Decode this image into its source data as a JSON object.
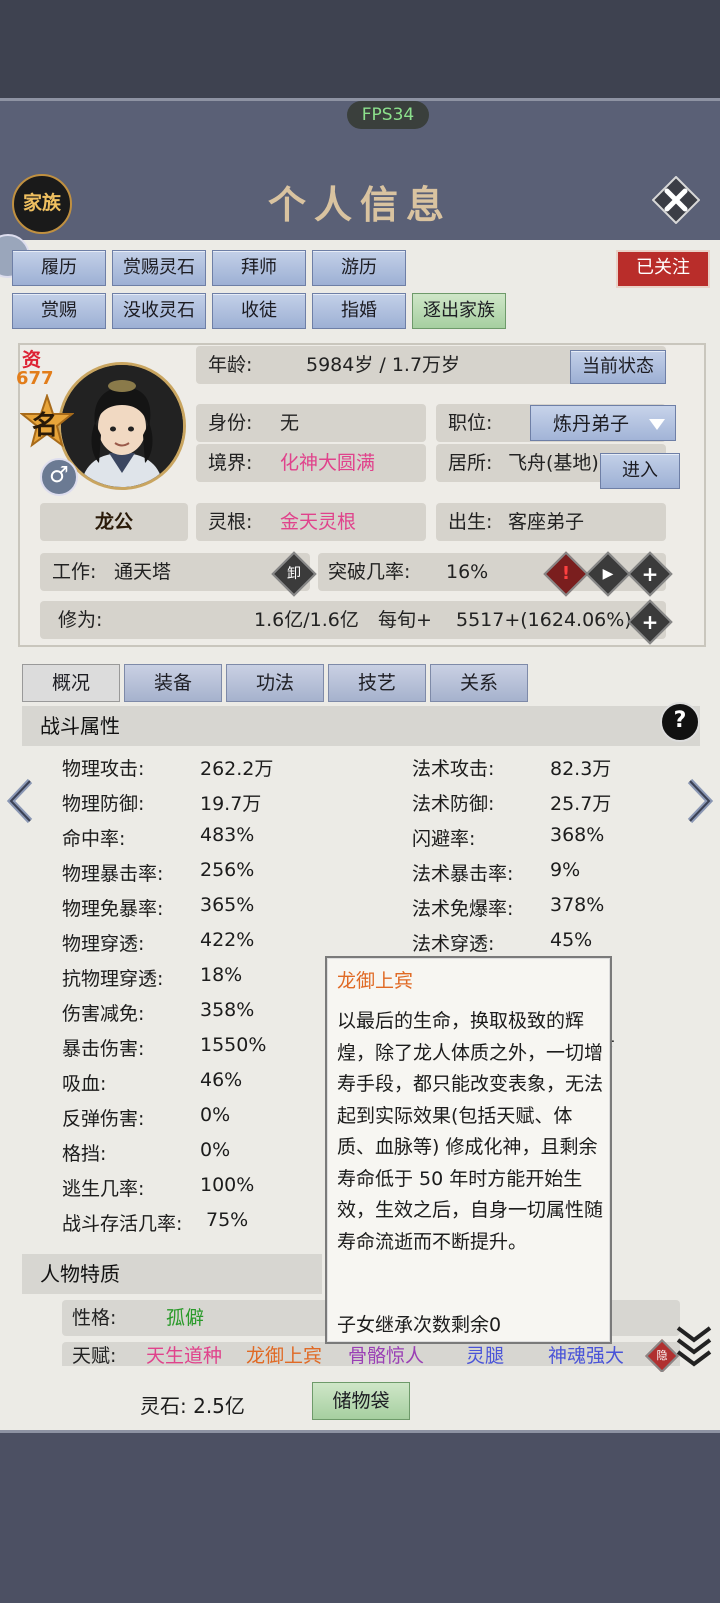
{
  "fps": "FPS34",
  "header": {
    "family_btn": "家族",
    "title": "个人信息"
  },
  "follow_btn": "已关注",
  "actions_row1": [
    "履历",
    "赏赐灵石",
    "拜师",
    "游历"
  ],
  "actions_row2": [
    "赏赐",
    "没收灵石",
    "收徒",
    "指婚"
  ],
  "expel_btn": "逐出家族",
  "badge": {
    "zi": "资",
    "zi_value": "677",
    "ming": "名"
  },
  "name": "龙公",
  "age": {
    "label": "年龄:",
    "value": "5984岁 / 1.7万岁",
    "status_btn": "当前状态"
  },
  "identity": {
    "label": "身份:",
    "value": "无"
  },
  "position": {
    "label": "职位:",
    "value": "炼丹弟子"
  },
  "realm": {
    "label": "境界:",
    "value": "化神大圆满"
  },
  "residence": {
    "label": "居所:",
    "value": "飞舟(基地)",
    "enter_btn": "进入"
  },
  "root": {
    "label": "灵根:",
    "value": "金天灵根"
  },
  "birth": {
    "label": "出生:",
    "value": "客座弟子"
  },
  "work": {
    "label": "工作:",
    "value": "通天塔",
    "icon_text": "卸"
  },
  "breakthrough": {
    "label": "突破几率:",
    "value": "16%"
  },
  "cultivation": {
    "label": "修为:",
    "value": "1.6亿/1.6亿",
    "rate_label": "每旬+",
    "rate_value": "5517+(1624.06%)"
  },
  "tabs": [
    "概况",
    "装备",
    "功法",
    "技艺",
    "关系"
  ],
  "combat_section": "战斗属性",
  "stats_left": [
    {
      "label": "物理攻击:",
      "value": "262.2万"
    },
    {
      "label": "物理防御:",
      "value": "19.7万"
    },
    {
      "label": "命中率:",
      "value": "483%"
    },
    {
      "label": "物理暴击率:",
      "value": "256%"
    },
    {
      "label": "物理免暴率:",
      "value": "365%"
    },
    {
      "label": "物理穿透:",
      "value": "422%"
    },
    {
      "label": "抗物理穿透:",
      "value": "18%"
    },
    {
      "label": "伤害减免:",
      "value": "358%"
    },
    {
      "label": "暴击伤害:",
      "value": "1550%"
    },
    {
      "label": "吸血:",
      "value": "46%"
    },
    {
      "label": "反弹伤害:",
      "value": "0%"
    },
    {
      "label": "格挡:",
      "value": "0%"
    },
    {
      "label": "逃生几率:",
      "value": "100%"
    },
    {
      "label": "战斗存活几率:",
      "value": "75%"
    }
  ],
  "stats_right": [
    {
      "label": "法术攻击:",
      "value": "82.3万"
    },
    {
      "label": "法术防御:",
      "value": "25.7万"
    },
    {
      "label": "闪避率:",
      "value": "368%"
    },
    {
      "label": "法术暴击率:",
      "value": "9%"
    },
    {
      "label": "法术免爆率:",
      "value": "378%"
    },
    {
      "label": "法术穿透:",
      "value": "45%"
    }
  ],
  "stats_right_partial": "万",
  "tooltip": {
    "title": "龙御上宾",
    "body": "以最后的生命，换取极致的辉煌，除了龙人体质之外，一切增寿手段，都只能改变表象，无法起到实际效果(包括天赋、体质、血脉等)  修成化神，且剩余寿命低于 50 年时方能开始生效，生效之后，自身一切属性随寿命流逝而不断提升。",
    "footer": "子女继承次数剩余0"
  },
  "traits_section": "人物特质",
  "personality": {
    "label": "性格:",
    "value": "孤僻"
  },
  "talents": {
    "label": "天赋:",
    "items": [
      {
        "text": "天生道种",
        "color": "#e0438c"
      },
      {
        "text": "龙御上宾",
        "color": "#e06a25"
      },
      {
        "text": "骨骼惊人",
        "color": "#9a3fb5"
      },
      {
        "text": "灵腿",
        "color": "#4a54d8"
      },
      {
        "text": "神魂强大",
        "color": "#4a54d8"
      }
    ],
    "hide_icon": "隐"
  },
  "spirit_stone": "灵石: 2.5亿",
  "storage_bag": "储物袋"
}
